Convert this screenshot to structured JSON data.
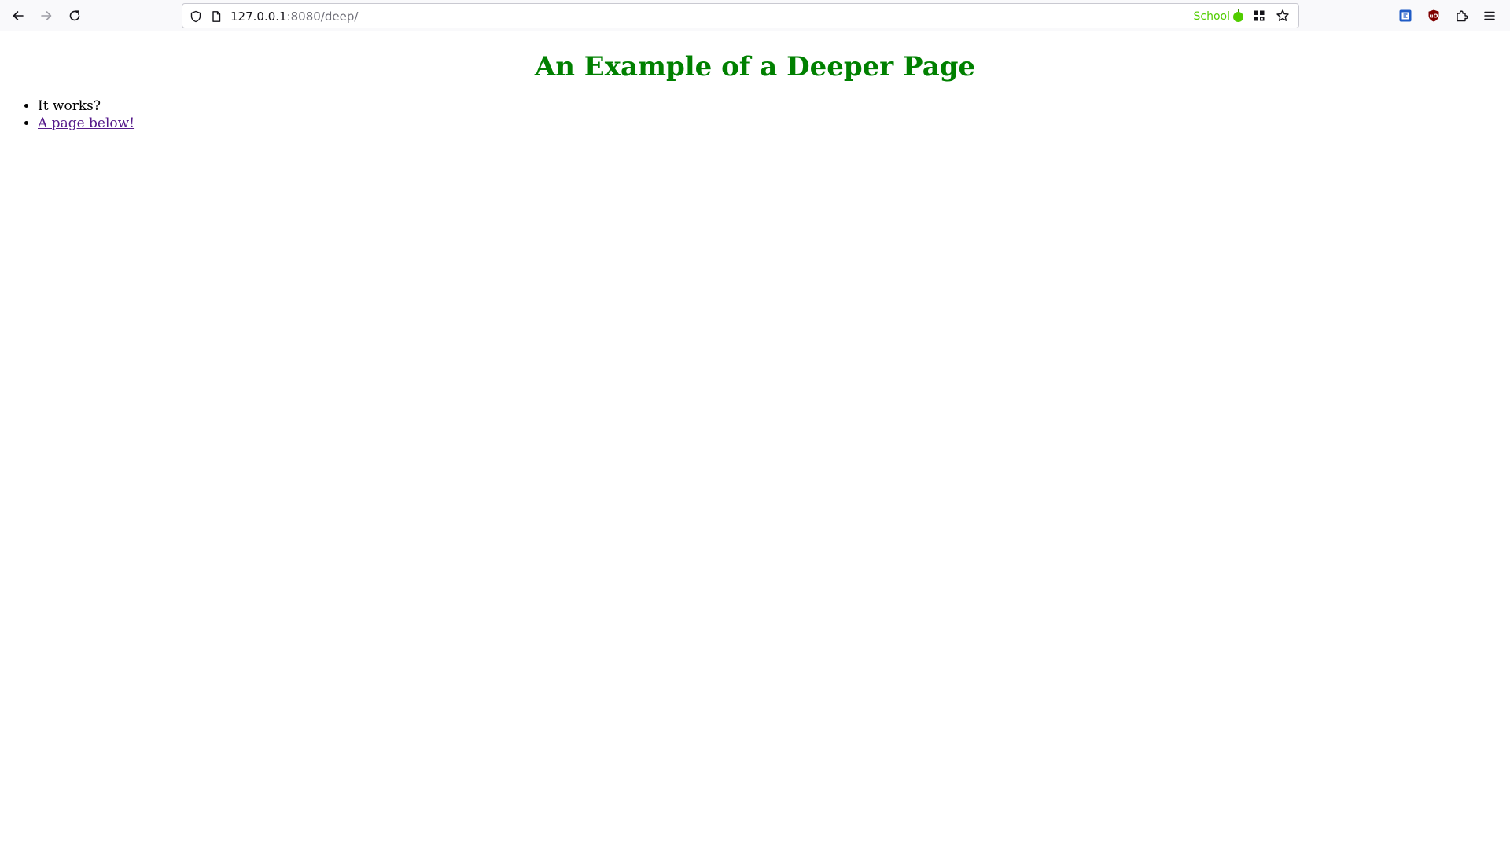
{
  "browser": {
    "url_host": "127.0.0.1",
    "url_rest": ":8080/deep/",
    "container_label": "School",
    "colors": {
      "container": "#51cd00",
      "heading": "#008000",
      "visited_link": "#551a8b"
    },
    "icons": [
      "back-arrow-icon",
      "forward-arrow-icon",
      "reload-icon",
      "shield-icon",
      "page-icon",
      "grid-icon",
      "bookmark-star-icon",
      "extension-blue-icon",
      "ublock-icon",
      "extensions-puzzle-icon",
      "hamburger-menu-icon"
    ]
  },
  "page": {
    "heading": "An Example of a Deeper Page",
    "items": [
      {
        "text": "It works?"
      },
      {
        "text": "A page below!"
      }
    ]
  }
}
